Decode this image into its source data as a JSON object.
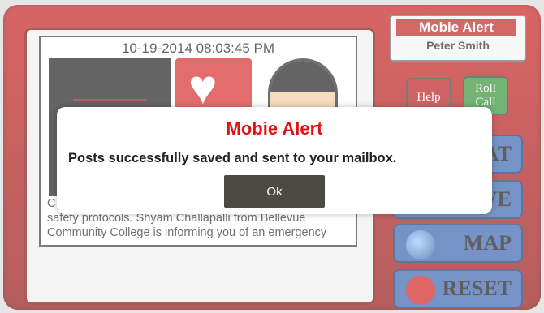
{
  "colors": {
    "frame_red": "#c51212",
    "dialog_title_red": "#e01212",
    "ok_button_bg": "#4b4a45",
    "side_button_blue": "#2c5aa8"
  },
  "app": {
    "name": "Mobie Alert",
    "user": "Peter Smith"
  },
  "post": {
    "timestamp": "10-19-2014 08:03:45 PM",
    "message_lines": [
      "C",
      "safety protocols. Shyam Challapalli from Bellevue",
      "Community College is informing you of an emergency"
    ]
  },
  "side_buttons": {
    "help": "Help",
    "roll_call": "Roll Call",
    "chat_partial": "AT",
    "save_partial": "VE",
    "map": "MAP",
    "reset": "RESET"
  },
  "icons": {
    "heart": "heart-monitor-icon",
    "avatar": "user-avatar-icon",
    "globe": "globe-icon",
    "power": "power-icon"
  },
  "dialog": {
    "title": "Mobie Alert",
    "message": "Posts successfully saved and sent to your mailbox.",
    "ok_label": "Ok"
  }
}
